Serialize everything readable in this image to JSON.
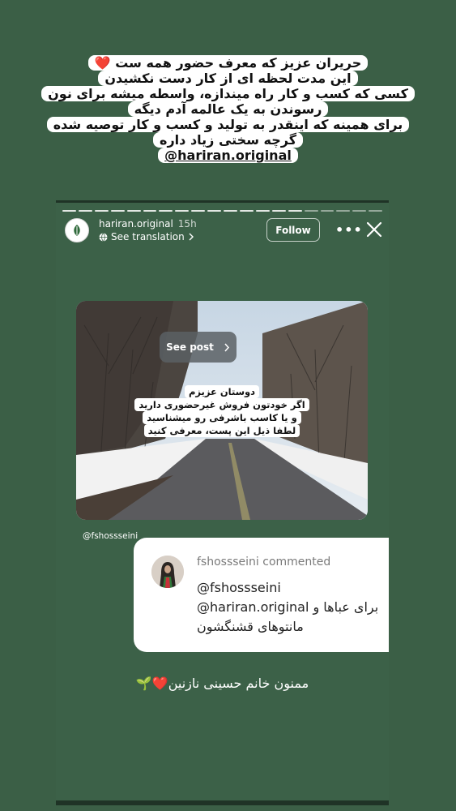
{
  "caption": {
    "line1": "حریران عزیز که معرف حضور همه ست",
    "line2": "این مدت لحظه ای از کار دست نکشیدن",
    "line3": "کسی که کسب و کار راه میندازه، واسطه میشه برای نون",
    "line4": "رسوندن به یک عالمه آدم دیگه",
    "line5": "برای همینه که اینقدر به تولید و کسب و کار توصیه شده",
    "line6": "گرچه سختی زیاد داره",
    "handle": "@hariran.original",
    "heart": "❤️"
  },
  "story": {
    "username": "hariran.original",
    "time": "15h",
    "see_translation": "See translation",
    "follow_label": "Follow",
    "more_label": "•••",
    "see_post_label": "See post",
    "photo_text": {
      "line1": "دوستان عزیزم",
      "line2": "اگر خودتون فروش غیرحضوری دارید",
      "line3": "و یا کاسب باشرفی رو میشناسید",
      "line4": "لطفا ذیل این پست، معرفی کنید"
    },
    "mention": "@fshossseini",
    "comment": {
      "title": "fshossseini commented",
      "line1": "@fshossseini",
      "line2": "@hariran.original برای عباها و",
      "line3": "مانتوهای قشنگشون"
    },
    "thanks": "ممنون خانم حسینی نازنین",
    "thanks_emoji": "❤️🌱"
  },
  "icons": {
    "close": "close-icon",
    "more": "more-options-icon",
    "chevron": "chevron-right-icon",
    "globe": "globe-icon"
  }
}
